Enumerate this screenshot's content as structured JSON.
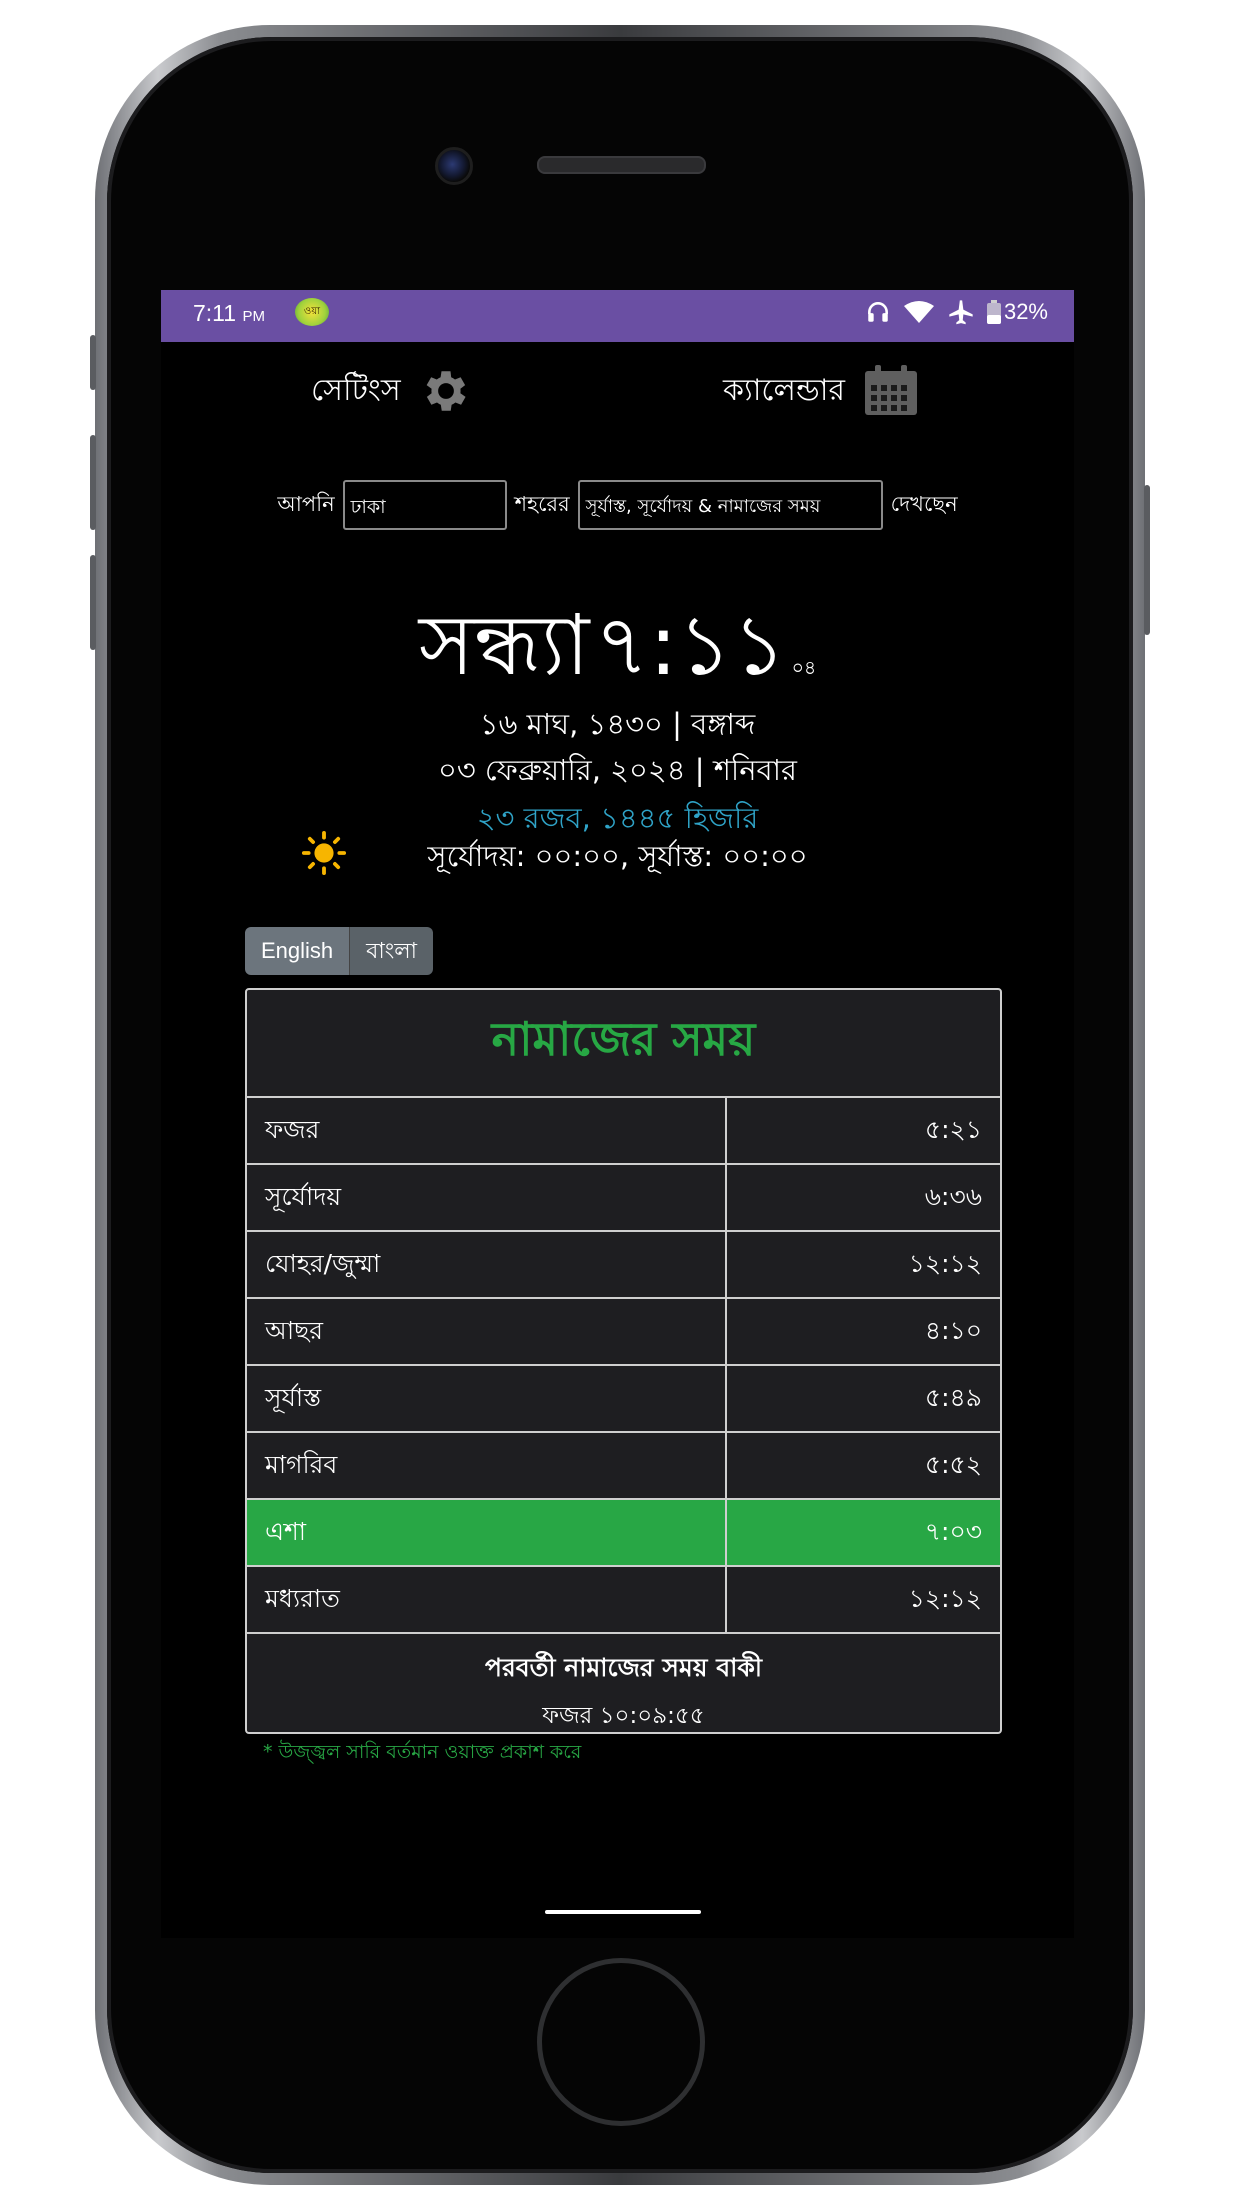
{
  "status_bar": {
    "time": "7:11",
    "ampm": "PM",
    "app_badge": "ওয়া",
    "battery": "32%",
    "color": "#6a4fa3"
  },
  "nav": {
    "settings_label": "সেটিংস",
    "settings_icon": "gear-icon",
    "calendar_label": "ক্যালেন্ডার",
    "calendar_icon": "calendar-icon"
  },
  "city_row": {
    "prefix": "আপনি",
    "city_value": "ঢাকা",
    "middle": "শহরের",
    "view_value": "সূর্যাস্ত, সূর্যোদয় & নামাজের সময়",
    "suffix": "দেখছেন"
  },
  "clock": {
    "period": "সন্ধ্যা",
    "time": "৭:১১",
    "seconds": "০৪"
  },
  "dates": {
    "bangla": "১৬ মাঘ, ১৪৩০ | বঙ্গাব্দ",
    "gregorian": "০৩ ফেব্রুয়ারি, ২০২৪ | শনিবার",
    "hijri": "২৩ রজব, ১৪৪৫ হিজরি",
    "hijri_color": "#2fa3c7"
  },
  "sun": {
    "icon": "sun-icon",
    "text": "সূর্যোদয়: ০০:০০, সূর্যাস্ত: ০০:০০"
  },
  "language": {
    "english": "English",
    "bangla": "বাংলা"
  },
  "prayer_table": {
    "title": "নামাজের সময়",
    "title_color": "#27a844",
    "rows": [
      {
        "name": "ফজর",
        "time": "৫:২১"
      },
      {
        "name": "সূর্যোদয়",
        "time": "৬:৩৬"
      },
      {
        "name": "যোহর/জুম্মা",
        "time": "১২:১২"
      },
      {
        "name": "আছর",
        "time": "৪:১০"
      },
      {
        "name": "সূর্যাস্ত",
        "time": "৫:৪৯"
      },
      {
        "name": "মাগরিব",
        "time": "৫:৫২"
      },
      {
        "name": "এশা",
        "time": "৭:০৩"
      },
      {
        "name": "মধ্যরাত",
        "time": "১২:১২"
      }
    ],
    "active_color": "#28a745",
    "footer_title": "পরবর্তী নামাজের সময় বাকী",
    "footer_value": "ফজর ১০:০৯:৫৫"
  },
  "note": "* উজ্জ্বল সারি বর্তমান ওয়াক্ত প্রকাশ করে"
}
